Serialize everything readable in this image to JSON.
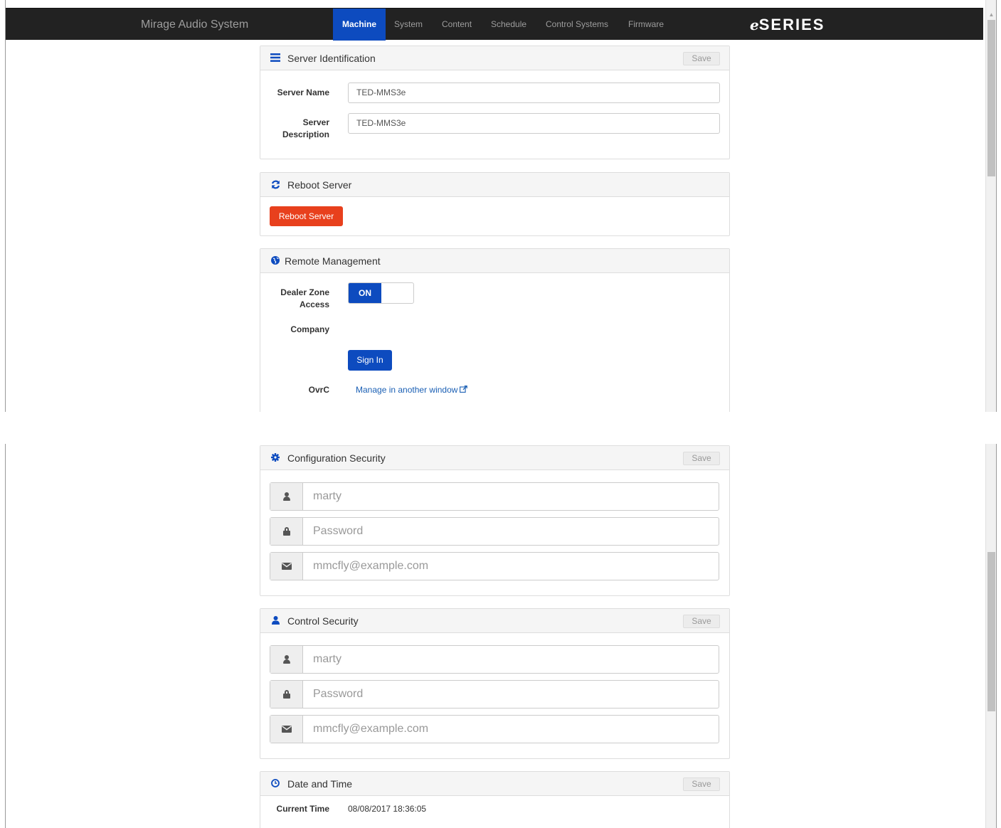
{
  "app": {
    "brand": "Mirage Audio System",
    "logo_e": "e",
    "logo_rest": "SERIES"
  },
  "nav": [
    {
      "label": "Machine",
      "active": true
    },
    {
      "label": "System"
    },
    {
      "label": "Content"
    },
    {
      "label": "Schedule"
    },
    {
      "label": "Control Systems"
    },
    {
      "label": "Firmware"
    }
  ],
  "server_identification": {
    "title": "Server Identification",
    "save_label": "Save",
    "server_name_label": "Server Name",
    "server_name_value": "TED-MMS3e",
    "server_description_label_1": "Server",
    "server_description_label_2": "Description",
    "server_description_value": "TED-MMS3e"
  },
  "reboot": {
    "title": "Reboot Server",
    "button_label": "Reboot Server"
  },
  "remote_management": {
    "title": "Remote Management",
    "dealer_zone_label_1": "Dealer Zone",
    "dealer_zone_label_2": "Access",
    "toggle_on_label": "ON",
    "toggle_state": "on",
    "company_label": "Company",
    "sign_in_label": "Sign In",
    "ovrc_label": "OvrC",
    "ovrc_link": "Manage in another window"
  },
  "configuration_security": {
    "title": "Configuration Security",
    "save_label": "Save",
    "username_placeholder": "marty",
    "password_placeholder": "Password",
    "email_placeholder": "mmcfly@example.com"
  },
  "control_security": {
    "title": "Control Security",
    "save_label": "Save",
    "username_placeholder": "marty",
    "password_placeholder": "Password",
    "email_placeholder": "mmcfly@example.com"
  },
  "date_time": {
    "title": "Date and Time",
    "save_label": "Save",
    "current_time_label": "Current Time",
    "current_time_value": "08/08/2017 18:36:05"
  },
  "colors": {
    "nav_bg": "#222222",
    "accent": "#0d4bbf",
    "danger": "#e8401d"
  },
  "icons": {
    "server_identification": "list-icon",
    "reboot": "refresh-icon",
    "remote_management": "globe-icon",
    "configuration_security": "gear-icon",
    "control_security": "user-icon",
    "date_time": "clock-icon",
    "username": "user-icon",
    "password": "lock-icon",
    "email": "envelope-icon",
    "external_link": "external-link-icon"
  }
}
